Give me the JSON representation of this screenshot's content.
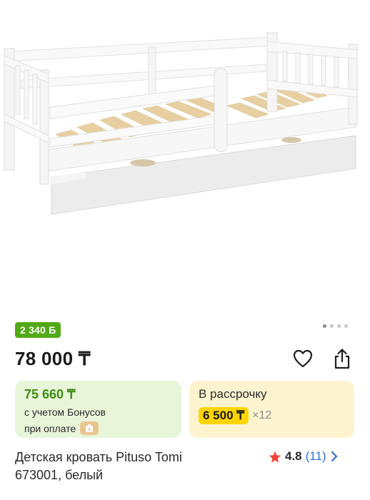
{
  "bonus_badge": {
    "text": "2 340 Б"
  },
  "gallery": {
    "total": 4,
    "active": 1
  },
  "price": {
    "main": "78 000 ₸"
  },
  "bonus_card": {
    "price": "75 660 ₸",
    "line1": "с учетом Бонусов",
    "line2": "при оплате"
  },
  "installment_card": {
    "title": "В рассрочку",
    "amount": "6 500 ₸",
    "months": "×12"
  },
  "product": {
    "title_line1": "Детская кровать Pituso Tomi",
    "title_line2": "673001, белый"
  },
  "rating": {
    "value": "4.8",
    "count": "(11)"
  },
  "colors": {
    "bonus_green": "#52a916",
    "bonus_card_bg": "#e8f5d9",
    "installment_card_bg": "#fdf4cf",
    "installment_highlight": "#ffd500",
    "star": "#f04438",
    "link": "#2f6fd6"
  },
  "icons": {
    "favorite": "heart-icon",
    "share": "share-icon",
    "star": "star-icon",
    "chevron": "chevron-right-icon",
    "payment": "wallet-icon"
  }
}
